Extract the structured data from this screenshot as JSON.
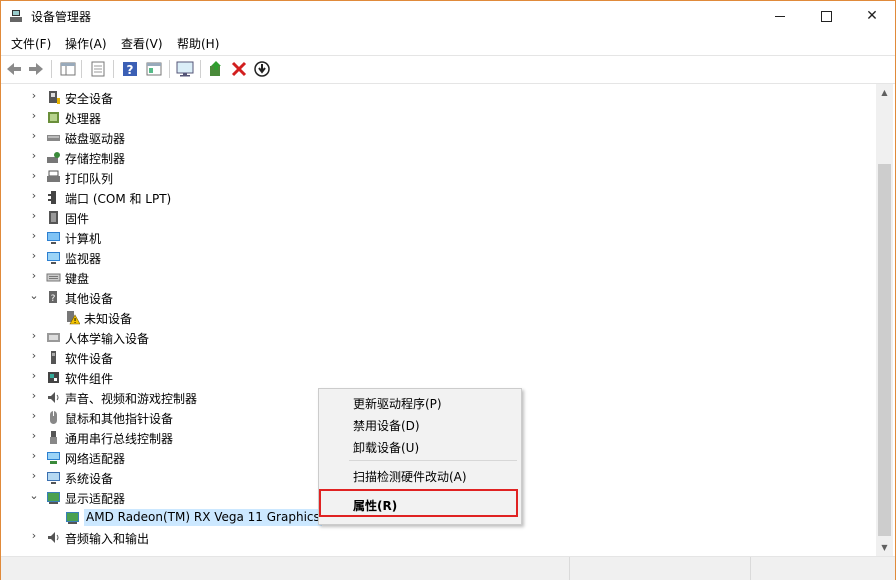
{
  "window": {
    "title": "设备管理器"
  },
  "menu": [
    "文件(F)",
    "操作(A)",
    "查看(V)",
    "帮助(H)"
  ],
  "tree": {
    "items": [
      {
        "label": "安全设备",
        "icon": "security-device-icon",
        "expanded": false
      },
      {
        "label": "处理器",
        "icon": "processor-icon",
        "expanded": false
      },
      {
        "label": "磁盘驱动器",
        "icon": "disk-drive-icon",
        "expanded": false
      },
      {
        "label": "存储控制器",
        "icon": "storage-controller-icon",
        "expanded": false
      },
      {
        "label": "打印队列",
        "icon": "printer-icon",
        "expanded": false
      },
      {
        "label": "端口 (COM 和 LPT)",
        "icon": "port-icon",
        "expanded": false
      },
      {
        "label": "固件",
        "icon": "firmware-icon",
        "expanded": false
      },
      {
        "label": "计算机",
        "icon": "computer-icon",
        "expanded": false
      },
      {
        "label": "监视器",
        "icon": "monitor-icon",
        "expanded": false
      },
      {
        "label": "键盘",
        "icon": "keyboard-icon",
        "expanded": false
      },
      {
        "label": "其他设备",
        "icon": "other-device-icon",
        "expanded": true
      },
      {
        "label": "未知设备",
        "icon": "unknown-device-warning-icon",
        "child": true
      },
      {
        "label": "人体学输入设备",
        "icon": "hid-icon",
        "expanded": false
      },
      {
        "label": "软件设备",
        "icon": "software-device-icon",
        "expanded": false
      },
      {
        "label": "软件组件",
        "icon": "software-component-icon",
        "expanded": false
      },
      {
        "label": "声音、视频和游戏控制器",
        "icon": "speaker-icon",
        "expanded": false
      },
      {
        "label": "鼠标和其他指针设备",
        "icon": "mouse-icon",
        "expanded": false
      },
      {
        "label": "通用串行总线控制器",
        "icon": "usb-icon",
        "expanded": false
      },
      {
        "label": "网络适配器",
        "icon": "network-adapter-icon",
        "expanded": false
      },
      {
        "label": "系统设备",
        "icon": "system-device-icon",
        "expanded": false
      },
      {
        "label": "显示适配器",
        "icon": "display-adapter-icon",
        "expanded": true
      },
      {
        "label": "AMD Radeon(TM) RX Vega 11 Graphics",
        "icon": "display-adapter-icon",
        "child": true,
        "selected": true
      },
      {
        "label": "音频输入和输出",
        "icon": "audio-io-icon",
        "expanded": false
      }
    ]
  },
  "context_menu": {
    "items": [
      "更新驱动程序(P)",
      "禁用设备(D)",
      "卸载设备(U)",
      "扫描检测硬件改动(A)",
      "属性(R)"
    ],
    "highlighted_index": 4,
    "highlight_color": "#e02222"
  },
  "colors": {
    "selection": "#cce8ff",
    "window_border": "#e08a3a"
  }
}
